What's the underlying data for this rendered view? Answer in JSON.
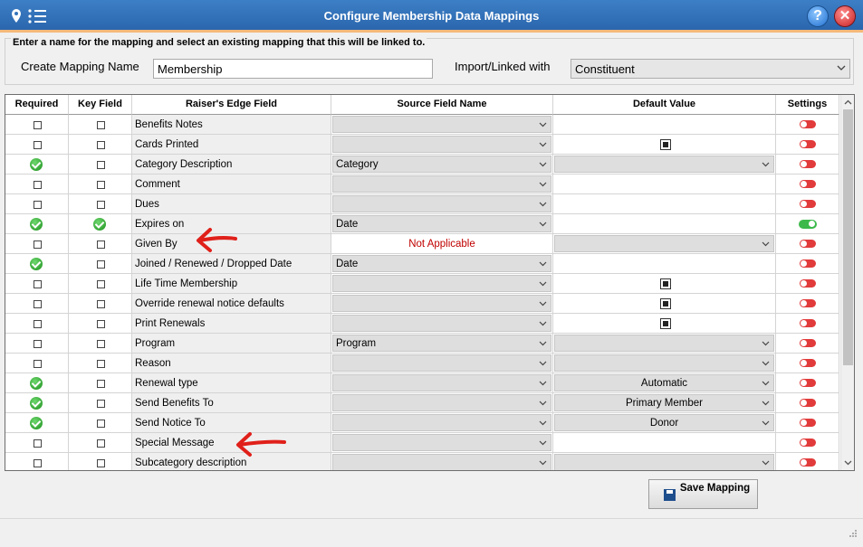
{
  "window": {
    "title": "Configure Membership Data Mappings"
  },
  "form": {
    "instructions": "Enter a name for the mapping and select an existing mapping that this will be linked to.",
    "name_label": "Create Mapping Name",
    "name_value": "Membership",
    "link_label": "Import/Linked with",
    "link_value": "Constituent"
  },
  "grid": {
    "headers": {
      "required": "Required",
      "key_field": "Key Field",
      "re_field": "Raiser's Edge Field",
      "source": "Source Field Name",
      "default": "Default Value",
      "settings": "Settings"
    },
    "rows": [
      {
        "required": false,
        "key": false,
        "field": "Benefits Notes",
        "source": "",
        "default_type": "text",
        "default": "",
        "setting": "off"
      },
      {
        "required": false,
        "key": false,
        "field": "Cards Printed",
        "source": "",
        "default_type": "checkbox",
        "default": "",
        "setting": "off"
      },
      {
        "required": true,
        "key": false,
        "field": "Category Description",
        "source": "Category",
        "default_type": "dropdown",
        "default": "",
        "setting": "off"
      },
      {
        "required": false,
        "key": false,
        "field": "Comment",
        "source": "",
        "default_type": "text",
        "default": "",
        "setting": "off"
      },
      {
        "required": false,
        "key": false,
        "field": "Dues",
        "source": "",
        "default_type": "text",
        "default": "",
        "setting": "off"
      },
      {
        "required": true,
        "key": true,
        "field": "Expires on",
        "source": "Date",
        "default_type": "text",
        "default": "",
        "setting": "on"
      },
      {
        "required": false,
        "key": false,
        "field": "Given By",
        "source": "Not Applicable",
        "default_type": "dropdown",
        "default": "",
        "setting": "off"
      },
      {
        "required": true,
        "key": false,
        "field": "Joined / Renewed / Dropped Date",
        "source": "Date",
        "default_type": "text",
        "default": "",
        "setting": "off"
      },
      {
        "required": false,
        "key": false,
        "field": "Life Time Membership",
        "source": "",
        "default_type": "checkbox",
        "default": "",
        "setting": "off"
      },
      {
        "required": false,
        "key": false,
        "field": "Override renewal notice defaults",
        "source": "",
        "default_type": "checkbox",
        "default": "",
        "setting": "off"
      },
      {
        "required": false,
        "key": false,
        "field": "Print Renewals",
        "source": "",
        "default_type": "checkbox",
        "default": "",
        "setting": "off"
      },
      {
        "required": false,
        "key": false,
        "field": "Program",
        "source": "Program",
        "default_type": "dropdown",
        "default": "",
        "setting": "off"
      },
      {
        "required": false,
        "key": false,
        "field": "Reason",
        "source": "",
        "default_type": "dropdown",
        "default": "",
        "setting": "off"
      },
      {
        "required": true,
        "key": false,
        "field": "Renewal type",
        "source": "",
        "default_type": "dropdown",
        "default": "Automatic",
        "setting": "off"
      },
      {
        "required": true,
        "key": false,
        "field": "Send Benefits To",
        "source": "",
        "default_type": "dropdown",
        "default": "Primary Member",
        "setting": "off"
      },
      {
        "required": true,
        "key": false,
        "field": "Send Notice To",
        "source": "",
        "default_type": "dropdown",
        "default": "Donor",
        "setting": "off"
      },
      {
        "required": false,
        "key": false,
        "field": "Special Message",
        "source": "",
        "default_type": "text",
        "default": "",
        "setting": "off"
      },
      {
        "required": false,
        "key": false,
        "field": "Subcategory description",
        "source": "",
        "default_type": "dropdown",
        "default": "",
        "setting": "off"
      }
    ]
  },
  "buttons": {
    "save": "Save Mapping"
  },
  "colors": {
    "titlebar": "#2a66ad",
    "toggle_off": "#e23b3b",
    "toggle_on": "#3cb94a",
    "not_applicable": "#c00000"
  }
}
